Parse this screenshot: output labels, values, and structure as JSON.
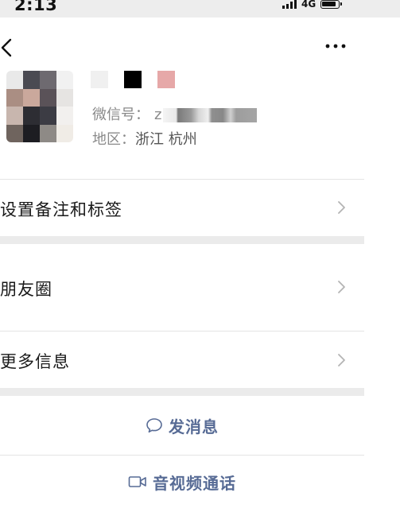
{
  "status_bar": {
    "time": "2:13",
    "network": "4G",
    "icons": [
      "signal-icon",
      "battery-icon"
    ]
  },
  "nav": {
    "back_icon": "chevron-left-icon",
    "more_icon": "ellipsis-icon"
  },
  "profile": {
    "wechat_id_label": "微信号：",
    "wechat_id_visible": "z",
    "region_label": "地区：",
    "region_value": "浙江 杭州"
  },
  "menu": {
    "remark_tags": "设置备注和标签",
    "moments": "朋友圈",
    "more_info": "更多信息"
  },
  "actions": {
    "send_message": "发消息",
    "av_call": "音视频通话"
  },
  "colors": {
    "accent": "#576b95",
    "separator": "#ebebeb",
    "background": "#ffffff"
  }
}
